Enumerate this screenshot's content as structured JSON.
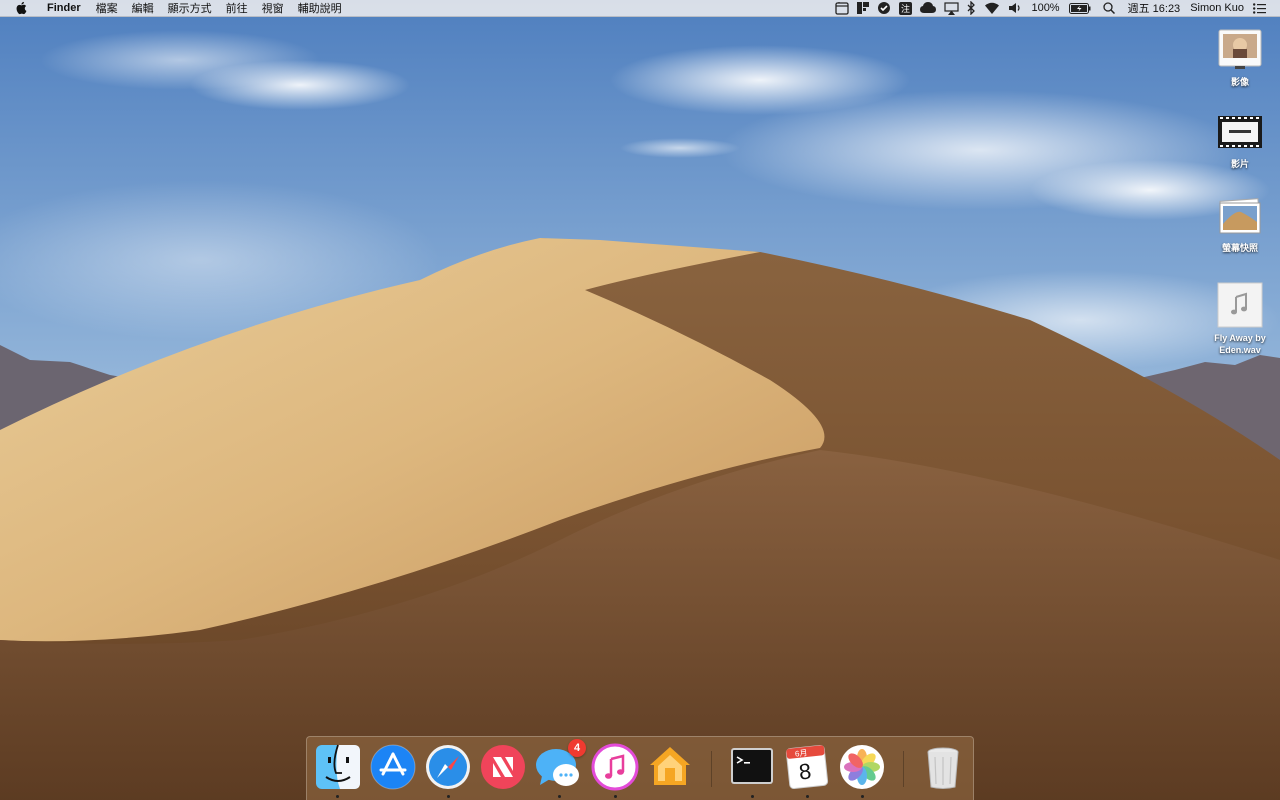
{
  "menubar": {
    "app_name": "Finder",
    "menus": [
      "檔案",
      "編輯",
      "顯示方式",
      "前往",
      "視窗",
      "輔助說明"
    ],
    "battery": "100%",
    "clock": "週五 16:23",
    "user": "Simon Kuo",
    "status_icons": [
      "notes-icon",
      "flipboard-icon",
      "vpn-icon",
      "dictionary-icon",
      "creative-cloud-icon",
      "airplay-icon",
      "bluetooth-icon",
      "wifi-icon",
      "volume-icon",
      "battery-icon",
      "spotlight-icon",
      "notification-center-icon"
    ]
  },
  "desktop": {
    "icons": [
      {
        "label": "影像",
        "icon": "image-folder-icon"
      },
      {
        "label": "影片",
        "icon": "video-file-icon"
      },
      {
        "label": "螢幕快照",
        "icon": "screenshot-folder-icon"
      },
      {
        "label": "Fly Away by Eden.wav",
        "icon": "audio-file-icon"
      }
    ]
  },
  "dock": {
    "apps": [
      {
        "name": "Finder",
        "icon": "finder-icon",
        "running": true
      },
      {
        "name": "App Store",
        "icon": "app-store-icon",
        "running": false
      },
      {
        "name": "Safari",
        "icon": "safari-icon",
        "running": true
      },
      {
        "name": "News",
        "icon": "news-icon",
        "running": false
      },
      {
        "name": "Messages",
        "icon": "messages-icon",
        "running": true,
        "badge": "4"
      },
      {
        "name": "iTunes",
        "icon": "itunes-icon",
        "running": true
      },
      {
        "name": "Home",
        "icon": "home-icon",
        "running": false
      },
      {
        "name": "Terminal",
        "icon": "terminal-icon",
        "running": true
      },
      {
        "name": "Calendar",
        "icon": "calendar-icon",
        "running": true,
        "month": "6月",
        "day": "8"
      },
      {
        "name": "Photos",
        "icon": "photos-icon",
        "running": true
      },
      {
        "name": "Trash",
        "icon": "trash-icon",
        "running": false
      }
    ]
  },
  "colors": {
    "sky_top": "#5a86c0",
    "sky_bottom": "#bcd2e6",
    "dune_light": "#e8c690",
    "dune_shadow": "#7a5533",
    "badge": "#f03a30"
  }
}
